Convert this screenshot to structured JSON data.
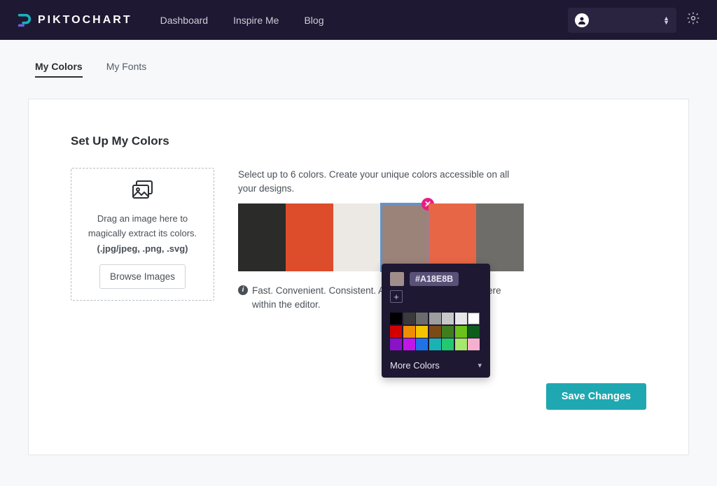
{
  "brand": "PIKTOCHART",
  "nav": {
    "dashboard": "Dashboard",
    "inspire": "Inspire Me",
    "blog": "Blog"
  },
  "tabs": {
    "colors": "My Colors",
    "fonts": "My Fonts"
  },
  "page": {
    "heading": "Set Up My Colors",
    "dropzone": {
      "line1": "Drag an image here to",
      "line2": "magically extract its colors.",
      "formats": "(.jpg/jpeg, .png, .svg)",
      "browse": "Browse Images"
    },
    "instructions": "Select up to 6 colors. Create your unique colors accessible on all your designs.",
    "swatches": [
      "#2b2b2a",
      "#dd4c2b",
      "#ece8e4",
      "#9c837a",
      "#e76646",
      "#6e6d69"
    ],
    "selected_index": 3,
    "hint": "Fast. Convenient. Consistent. Access your colors anywhere within the editor.",
    "save": "Save Changes"
  },
  "picker": {
    "hex": "#A18E8B",
    "preview": "#a18e8b",
    "palette": [
      "#000000",
      "#3a3a3a",
      "#6b6b6b",
      "#9d9d9d",
      "#c8c8c8",
      "#e6e6e6",
      "#ffffff",
      "#d40000",
      "#ef8d00",
      "#f5c400",
      "#7a4a17",
      "#3f7d1e",
      "#6cc21a",
      "#0f5d1e",
      "#8a12c7",
      "#c017e8",
      "#1e73e8",
      "#19b3b3",
      "#22c96f",
      "#a6e86c",
      "#f6b0cf"
    ],
    "more": "More Colors"
  }
}
